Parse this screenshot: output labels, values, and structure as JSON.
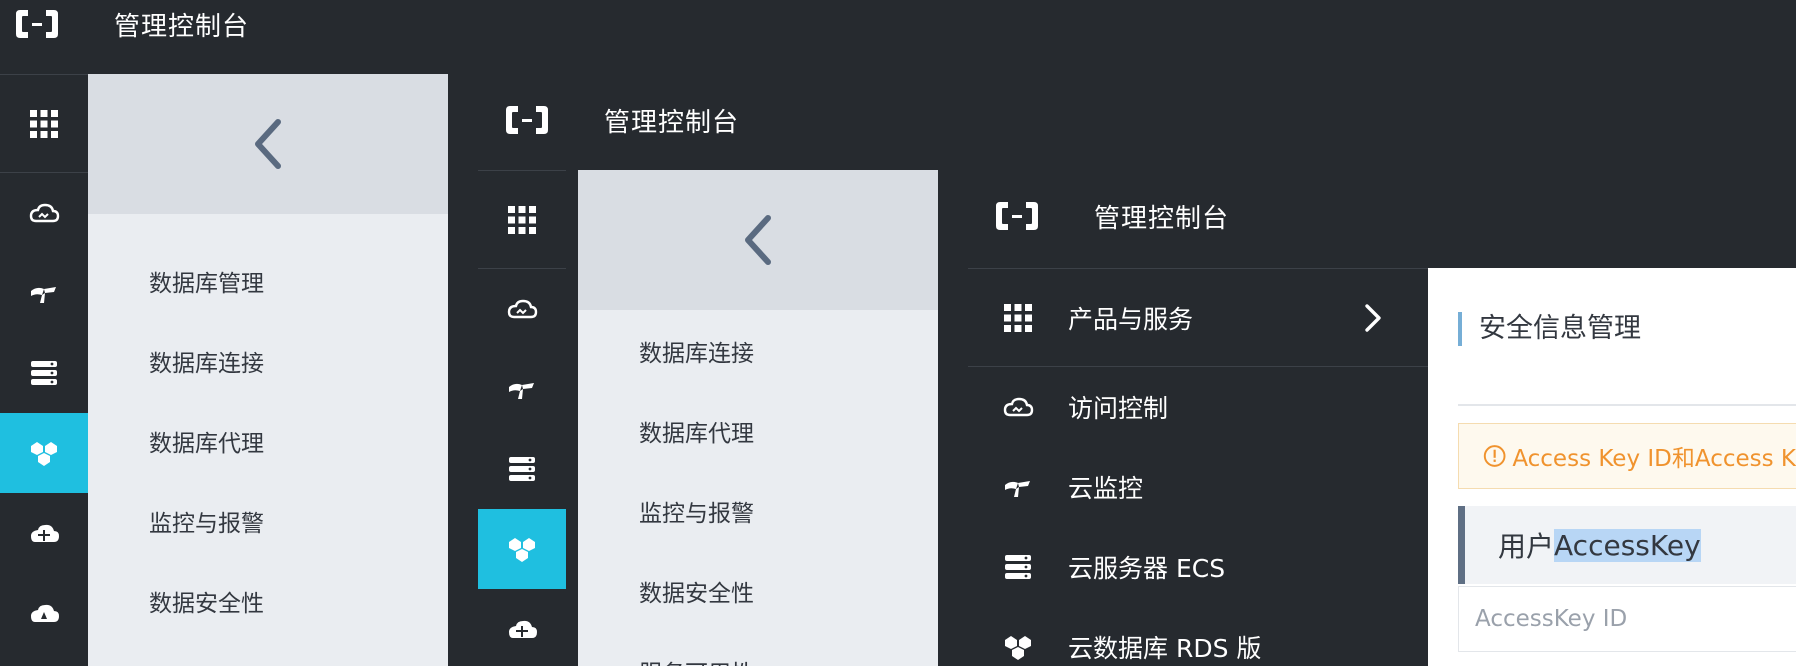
{
  "app": {
    "title": "管理控制台"
  },
  "icons": {
    "logo": "alibaba-cloud-logo",
    "grid": "grid-icon",
    "cloud": "cloud-icon",
    "monitor": "gauge-icon",
    "server": "server-icon",
    "database": "rds-icon",
    "cloud_db": "cloud-db-icon",
    "rocket": "rocket-icon",
    "back": "chevron-left-icon",
    "forward": "chevron-right-icon",
    "alert": "exclamation-circle-icon"
  },
  "colors": {
    "topbar": "#262a2f",
    "accent": "#1fbfe0",
    "submenu_bg": "#eaedf1",
    "submenu_head": "#d9dde3",
    "alert_text": "#f0932e",
    "highlight": "#b8d6f5"
  },
  "panel1": {
    "submenu_items": [
      "数据库管理",
      "数据库连接",
      "数据库代理",
      "监控与报警",
      "数据安全性"
    ]
  },
  "panel2": {
    "submenu_items": [
      "数据库连接",
      "数据库代理",
      "监控与报警",
      "数据安全性",
      "服务可用性"
    ]
  },
  "panel3": {
    "products_label": "产品与服务",
    "nav_items": [
      "访问控制",
      "云监控",
      "云服务器 ECS",
      "云数据库 RDS 版"
    ],
    "section_title": "安全信息管理",
    "alert_text": "Access Key ID和Access K",
    "accesskey_prefix": "用户",
    "accesskey_highlight": "AccessKey",
    "accesskey_id_label": "AccessKey ID"
  }
}
